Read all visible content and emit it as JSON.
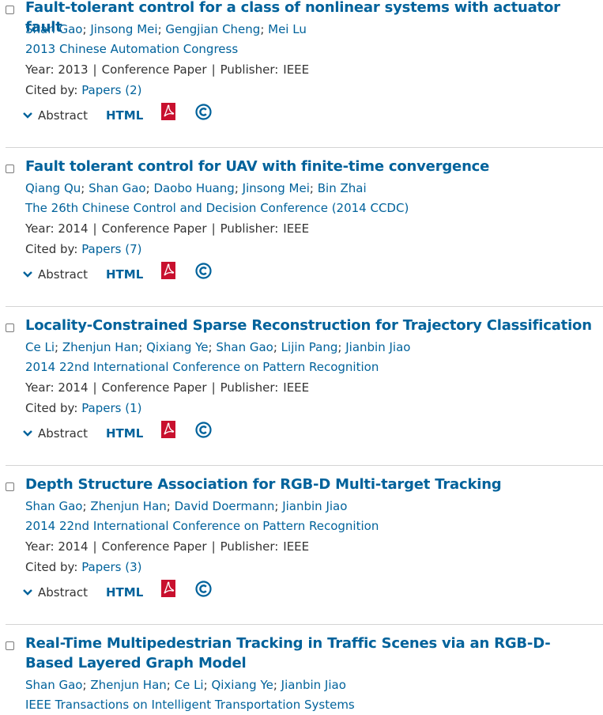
{
  "results": [
    {
      "title": "Fault-tolerant control for a class of nonlinear systems with actuator fault",
      "authors": [
        "Shan Gao",
        "Jinsong Mei",
        "Gengjian Cheng",
        "Mei Lu"
      ],
      "venue": "2013 Chinese Automation Congress",
      "year_label": "Year:",
      "year": "2013",
      "type": "Conference Paper",
      "publisher_label": "Publisher:",
      "publisher": "IEEE",
      "cited_label": "Cited by:",
      "cited": "Papers (2)",
      "abstract_label": "Abstract",
      "html_label": "HTML"
    },
    {
      "title": "Fault tolerant control for UAV with finite-time convergence",
      "authors": [
        "Qiang Qu",
        "Shan Gao",
        "Daobo Huang",
        "Jinsong Mei",
        "Bin Zhai"
      ],
      "venue": "The 26th Chinese Control and Decision Conference (2014 CCDC)",
      "year_label": "Year:",
      "year": "2014",
      "type": "Conference Paper",
      "publisher_label": "Publisher:",
      "publisher": "IEEE",
      "cited_label": "Cited by:",
      "cited": "Papers (7)",
      "abstract_label": "Abstract",
      "html_label": "HTML"
    },
    {
      "title": "Locality-Constrained Sparse Reconstruction for Trajectory Classification",
      "authors": [
        "Ce Li",
        "Zhenjun Han",
        "Qixiang Ye",
        "Shan Gao",
        "Lijin Pang",
        "Jianbin Jiao"
      ],
      "venue": "2014 22nd International Conference on Pattern Recognition",
      "year_label": "Year:",
      "year": "2014",
      "type": "Conference Paper",
      "publisher_label": "Publisher:",
      "publisher": "IEEE",
      "cited_label": "Cited by:",
      "cited": "Papers (1)",
      "abstract_label": "Abstract",
      "html_label": "HTML"
    },
    {
      "title": "Depth Structure Association for RGB-D Multi-target Tracking",
      "authors": [
        "Shan Gao",
        "Zhenjun Han",
        "David Doermann",
        "Jianbin Jiao"
      ],
      "venue": "2014 22nd International Conference on Pattern Recognition",
      "year_label": "Year:",
      "year": "2014",
      "type": "Conference Paper",
      "publisher_label": "Publisher:",
      "publisher": "IEEE",
      "cited_label": "Cited by:",
      "cited": "Papers (3)",
      "abstract_label": "Abstract",
      "html_label": "HTML"
    },
    {
      "title": "Real-Time Multipedestrian Tracking in Traffic Scenes via an RGB-D-Based Layered Graph Model",
      "authors": [
        "Shan Gao",
        "Zhenjun Han",
        "Ce Li",
        "Qixiang Ye",
        "Jianbin Jiao"
      ],
      "venue": "IEEE Transactions on Intelligent Transportation Systems"
    }
  ],
  "colors": {
    "link": "#00629b",
    "text": "#333333",
    "pdf_red": "#c8102e",
    "separator": "#d4d4d4"
  },
  "icons": {
    "checkbox": "checkbox-icon",
    "chevron": "chevron-down-icon",
    "pdf": "pdf-icon",
    "copyright": "copyright-icon"
  }
}
